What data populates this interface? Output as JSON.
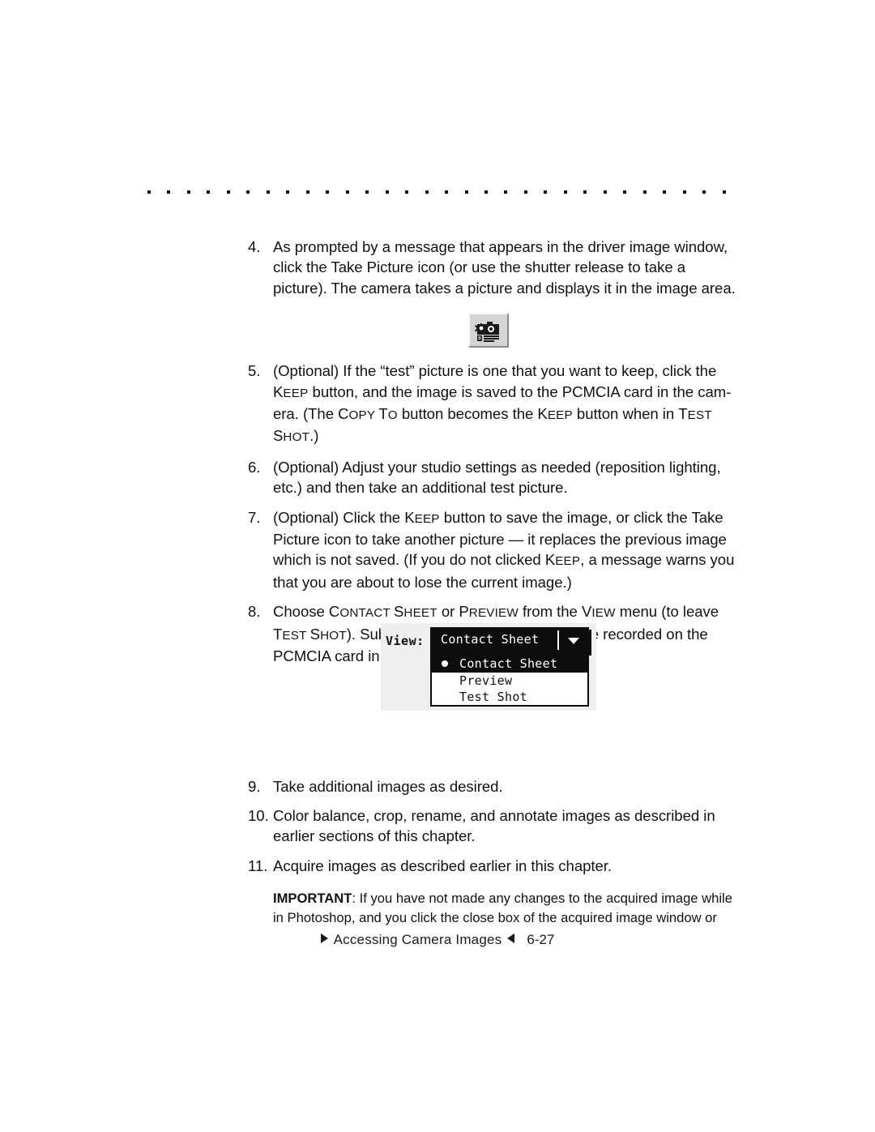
{
  "page": {
    "rule": {
      "dot_count": 30
    },
    "footer": {
      "section_title": "Accessing Camera Images",
      "page_number": "6-27",
      "left_marker_icon": "triangle-right-icon",
      "right_marker_icon": "triangle-left-icon"
    }
  },
  "steps": [
    {
      "number": "4.",
      "text": "As prompted by a message that appears in the driver image window, click the Take Picture icon (or use the shutter release to take a picture). The camera takes a picture and displays it in the image area."
    },
    {
      "number": "5.",
      "parts": [
        {
          "type": "plain",
          "text": "(Optional) If the “test” picture is one that you want to keep, click the "
        },
        {
          "type": "smallcaps",
          "text": "Keep"
        },
        {
          "type": "plain",
          "text": " button, and the image is saved to the PCMCIA card in the cam-era. (The "
        },
        {
          "type": "smallcaps",
          "text": "Copy To"
        },
        {
          "type": "plain",
          "text": " button becomes the "
        },
        {
          "type": "smallcaps",
          "text": "Keep"
        },
        {
          "type": "plain",
          "text": " button when in "
        },
        {
          "type": "smallcaps",
          "text": "Test Shot"
        },
        {
          "type": "plain",
          "text": ".)"
        }
      ]
    },
    {
      "number": "6.",
      "text": "(Optional) Adjust your studio settings as needed (reposition lighting, etc.) and then take an additional test picture."
    },
    {
      "number": "7.",
      "parts": [
        {
          "type": "plain",
          "text": "(Optional) Click the "
        },
        {
          "type": "smallcaps",
          "text": "Keep"
        },
        {
          "type": "plain",
          "text": " button to save the image, or click the Take Picture icon to take another picture — it replaces the previous image which is not saved. (If you do not clicked "
        },
        {
          "type": "smallcaps",
          "text": "Keep"
        },
        {
          "type": "plain",
          "text": ", a message warns you that you are about to lose the current image.)"
        }
      ]
    },
    {
      "number": "8.",
      "parts": [
        {
          "type": "plain",
          "text": "Choose "
        },
        {
          "type": "smallcaps",
          "text": "Contact Sheet"
        },
        {
          "type": "plain",
          "text": " or "
        },
        {
          "type": "smallcaps",
          "text": "Preview"
        },
        {
          "type": "plain",
          "text": " from the "
        },
        {
          "type": "smallcaps",
          "text": "View"
        },
        {
          "type": "plain",
          "text": " menu (to leave "
        },
        {
          "type": "smallcaps",
          "text": "Test Shot"
        },
        {
          "type": "plain",
          "text": "). Subsequent images you take will be recorded on the PCMCIA card in the camera."
        }
      ]
    },
    {
      "number": "9.",
      "text": "Take additional images as desired."
    },
    {
      "number": "10.",
      "text": "Color balance, crop, rename, and annotate images as described in earlier sections of this chapter."
    },
    {
      "number": "11.",
      "text": "Acquire images as described earlier in this chapter."
    }
  ],
  "important_note": {
    "label": "IMPORTANT",
    "separator": ": ",
    "text": "If you have not made any changes to the acquired image while in Photoshop, and you click the close box of the acquired image window or"
  },
  "figures": {
    "take_picture_icon": {
      "name": "take-picture-icon",
      "alt": "Take Picture toolbar button with camera and flash burst"
    },
    "view_menu": {
      "label": "View:",
      "selected_value": "Contact Sheet",
      "caret_icon": "chevron-down-icon",
      "options": [
        {
          "label": "Contact Sheet",
          "selected": true
        },
        {
          "label": "Preview",
          "selected": false
        },
        {
          "label": "Test Shot",
          "selected": false
        }
      ]
    }
  },
  "colors": {
    "text": "#121212",
    "figure_background": "#efefef",
    "menu_background": "#0d0d0d",
    "menu_text": "#ffffff",
    "icon_face": "#d4d4d4"
  }
}
